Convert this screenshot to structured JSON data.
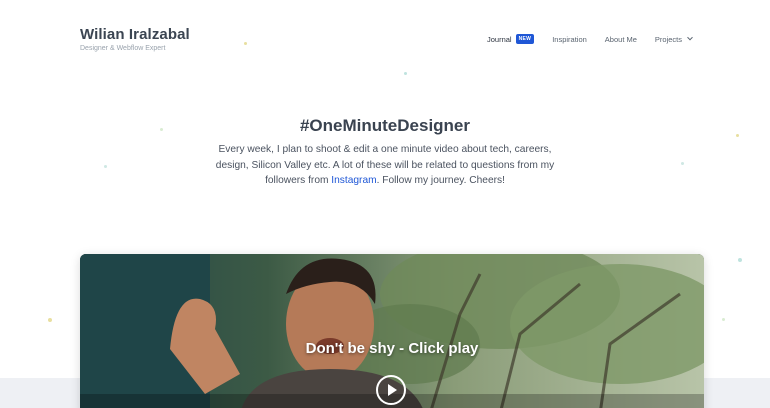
{
  "header": {
    "brand_name": "Wilian Iralzabal",
    "brand_tagline": "Designer & Webflow Expert",
    "nav": {
      "journal": "Journal",
      "journal_badge": "NEW",
      "inspiration": "Inspiration",
      "about": "About Me",
      "projects": "Projects"
    }
  },
  "hero": {
    "title": "#OneMinuteDesigner",
    "body_before_link": "Every week, I plan to shoot & edit a one minute video about tech, careers, design, Silicon Valley etc. A lot of these will be related to questions from my followers from ",
    "link_text": "Instagram",
    "body_after_link": ". Follow my journey. Cheers!"
  },
  "video": {
    "caption": "Don't be shy - Click play"
  },
  "colors": {
    "accent": "#1f57d6",
    "brand_text": "#3b4552"
  }
}
